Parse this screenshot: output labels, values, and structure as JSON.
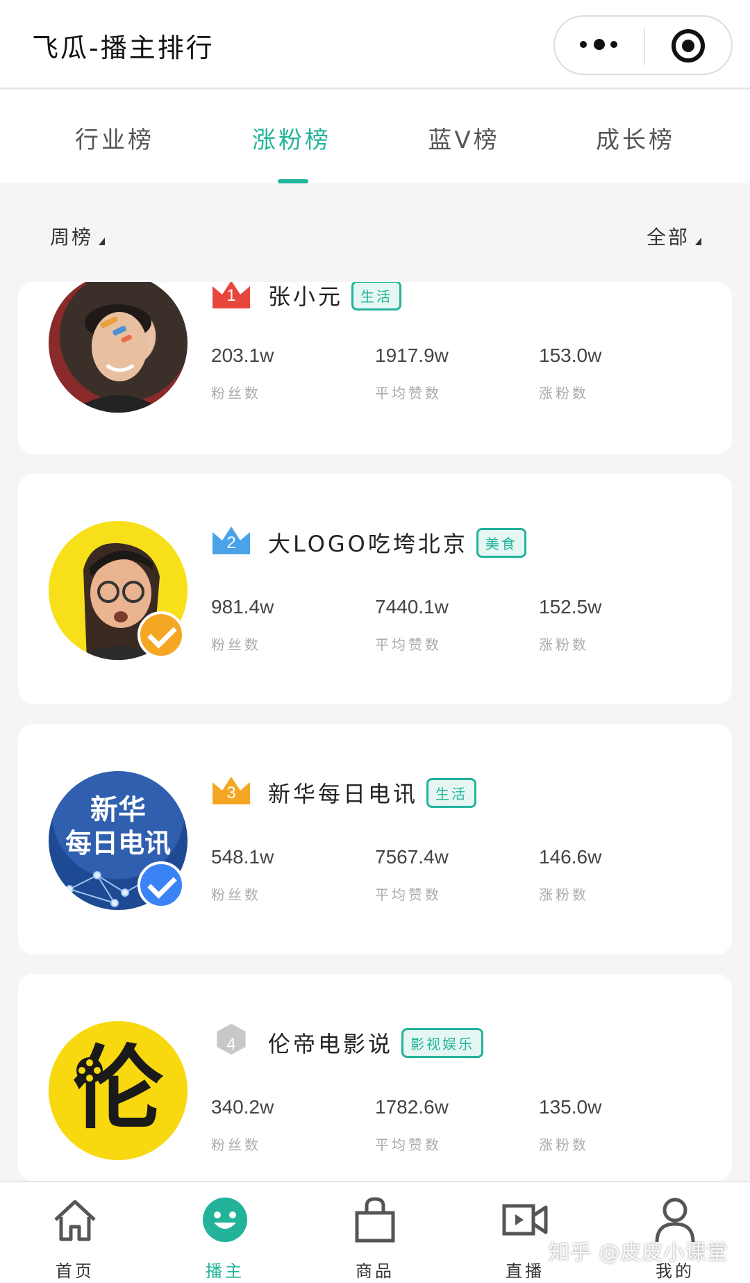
{
  "header": {
    "title": "飞瓜-播主排行"
  },
  "tabs": [
    {
      "label": "行业榜",
      "active": false
    },
    {
      "label": "涨粉榜",
      "active": true
    },
    {
      "label": "蓝V榜",
      "active": false
    },
    {
      "label": "成长榜",
      "active": false
    }
  ],
  "filters": {
    "period": "周榜",
    "category": "全部"
  },
  "stat_labels": {
    "fans": "粉丝数",
    "likes": "平均赞数",
    "growth": "涨粉数"
  },
  "ranking": [
    {
      "rank": "1",
      "name": "张小元",
      "tag": "生活",
      "fans": "203.1w",
      "likes": "1917.9w",
      "growth": "153.0w",
      "verified": false
    },
    {
      "rank": "2",
      "name": "大LOGO吃垮北京",
      "tag": "美食",
      "fans": "981.4w",
      "likes": "7440.1w",
      "growth": "152.5w",
      "verified": true,
      "verify_color": "#f5a623"
    },
    {
      "rank": "3",
      "name": "新华每日电讯",
      "tag": "生活",
      "fans": "548.1w",
      "likes": "7567.4w",
      "growth": "146.6w",
      "verified": true,
      "verify_color": "#3b82f6",
      "avatar_text": [
        "新华",
        "每日电讯"
      ]
    },
    {
      "rank": "4",
      "name": "伦帝电影说",
      "tag": "影视娱乐",
      "fans": "340.2w",
      "likes": "1782.6w",
      "growth": "135.0w",
      "verified": false,
      "avatar_text": [
        "伦"
      ]
    }
  ],
  "bottom_nav": [
    {
      "label": "首页",
      "icon": "home-icon",
      "active": false
    },
    {
      "label": "播主",
      "icon": "smiley-icon",
      "active": true
    },
    {
      "label": "商品",
      "icon": "bag-icon",
      "active": false
    },
    {
      "label": "直播",
      "icon": "video-camera-icon",
      "active": false
    },
    {
      "label": "我的",
      "icon": "user-icon",
      "active": false
    }
  ],
  "watermark": "知乎 @皮皮小课堂",
  "colors": {
    "accent": "#22b39a",
    "rank1": "#e8463c",
    "rank2": "#4aa3e8",
    "rank3": "#f5a623",
    "rank4": "#c8c8c8"
  }
}
